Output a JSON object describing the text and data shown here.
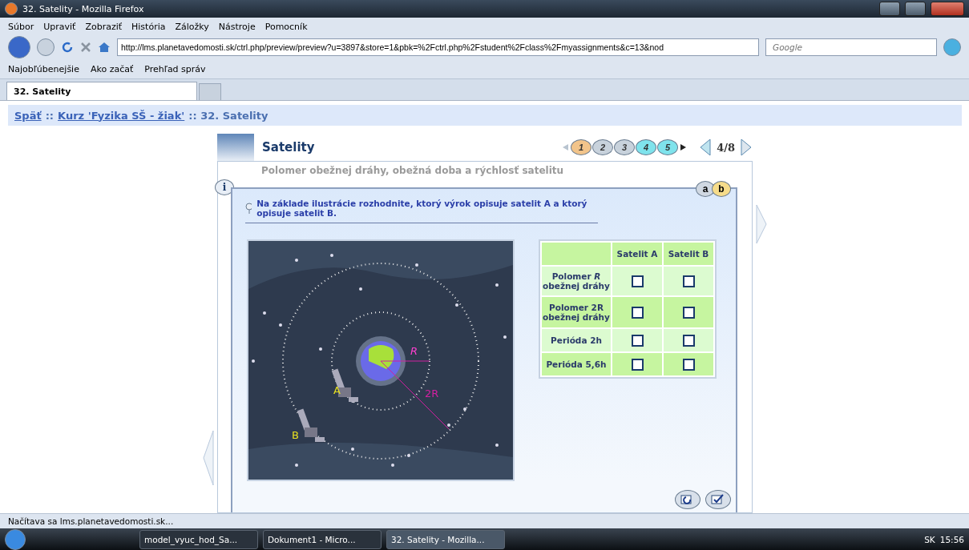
{
  "window": {
    "title": "32. Satelity - Mozilla Firefox"
  },
  "menu": [
    "Súbor",
    "Upraviť",
    "Zobraziť",
    "História",
    "Záložky",
    "Nástroje",
    "Pomocník"
  ],
  "address": {
    "value": "http://lms.planetavedomosti.sk/ctrl.php/preview/preview?u=3897&store=1&pbk=%2Fctrl.php%2Fstudent%2Fclass%2Fmyassignments&c=13&nod"
  },
  "search": {
    "placeholder": "Google"
  },
  "bookmarks": [
    "Najobľúbenejšie",
    "Ako začať",
    "Prehľad správ"
  ],
  "tabs": [
    {
      "label": "32. Satelity",
      "selected": true
    }
  ],
  "breadcrumb": [
    {
      "text": "Späť",
      "link": true
    },
    {
      "text": "::",
      "link": false
    },
    {
      "text": "Kurz 'Fyzika SŠ - žiak'",
      "link": true
    },
    {
      "text": ":: 32. Satelity",
      "link": false
    }
  ],
  "lesson": {
    "title": "Satelity",
    "subtitle": "Polomer obežnej dráhy, obežná doba a rýchlosť satelitu",
    "pages": [
      {
        "label": "1",
        "color": "#f2c48a"
      },
      {
        "label": "2",
        "color": "#c8d2dc"
      },
      {
        "label": "3",
        "color": "#c8d2dc"
      },
      {
        "label": "4",
        "color": "#7fe3ec"
      },
      {
        "label": "5",
        "color": "#7fe3ec"
      }
    ],
    "counter": "4/8",
    "info": "i",
    "variants": [
      {
        "label": "a",
        "selected": false
      },
      {
        "label": "b",
        "selected": true
      }
    ],
    "question": "Na základe ilustrácie rozhodnite, ktorý výrok opisuje satelit A a ktorý opisuje satelit B.",
    "illustration": {
      "label_a": "A",
      "label_b": "B",
      "label_r": "R",
      "label_2r": "2R"
    },
    "table": {
      "columns": [
        "Satelit A",
        "Satelit B"
      ],
      "rows": [
        {
          "label": "Polomer *R* obežnej dráhy",
          "checks": [
            false,
            false
          ]
        },
        {
          "label": "Polomer 2R obežnej dráhy",
          "checks": [
            false,
            false
          ]
        },
        {
          "label": "Perióda 2h",
          "checks": [
            false,
            false
          ]
        },
        {
          "label": "Perióda 5,6h",
          "checks": [
            false,
            false
          ]
        }
      ]
    }
  },
  "status_bar": {
    "text": "Načítava sa lms.planetavedomosti.sk..."
  },
  "taskbar": {
    "items": [
      {
        "label": "model_vyuc_hod_Sa...",
        "selected": false
      },
      {
        "label": "Dokument1 - Micro...",
        "selected": false
      },
      {
        "label": "32. Satelity - Mozilla...",
        "selected": true
      }
    ],
    "language": "SK",
    "time": "15:56"
  }
}
